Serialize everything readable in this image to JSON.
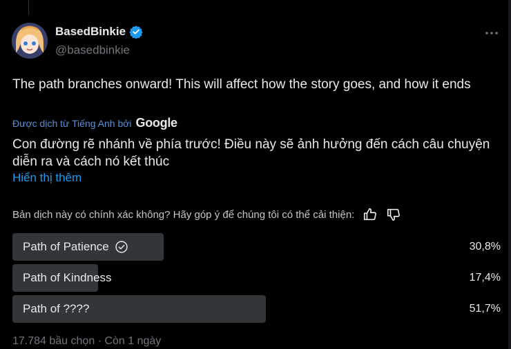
{
  "author": {
    "display_name": "BasedBinkie",
    "handle": "@basedbinkie"
  },
  "tweet": {
    "text": "The path branches onward! This will affect how the story goes, and how it ends",
    "translated_by_prefix": "Được dịch từ Tiếng Anh bởi",
    "translator": "Google",
    "translated_text": "Con đường rẽ nhánh về phía trước! Điều này sẽ ảnh hưởng đến cách câu chuyện diễn ra và cách nó kết thúc",
    "show_more": "Hiển thị thêm"
  },
  "feedback": {
    "prompt": "Bản dịch này có chính xác không? Hãy góp ý để chúng tôi có thể cải thiện:"
  },
  "poll": {
    "options": [
      {
        "label": "Path of Patience",
        "percent_text": "30,8%",
        "percent": 30.8,
        "selected": true
      },
      {
        "label": "Path of Kindness",
        "percent_text": "17,4%",
        "percent": 17.4,
        "selected": false
      },
      {
        "label": "Path of ????",
        "percent_text": "51,7%",
        "percent": 51.7,
        "selected": false
      }
    ],
    "meta": "17.784 bầu chọn · Còn 1 ngày"
  },
  "colors": {
    "background": "#000000",
    "text": "#e7e9ea",
    "secondary_text": "#71767b",
    "link": "#1d9bf0",
    "verified": "#1d9bf0",
    "poll_bar": "#333639"
  }
}
